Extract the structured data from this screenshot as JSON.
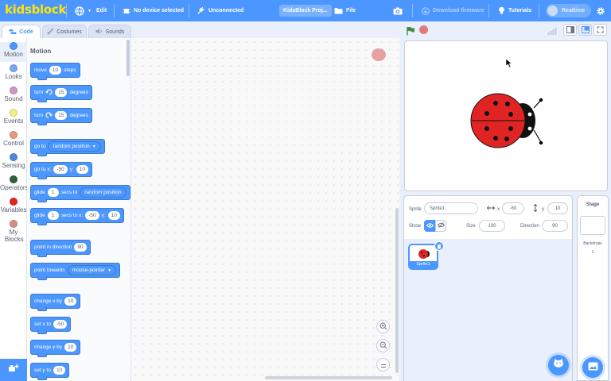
{
  "menubar": {
    "logo": "kidsblock",
    "edit": "Edit",
    "device": "No device selected",
    "connection": "Unconnected",
    "project_title": "KidsBlock Proj...",
    "file": "File",
    "download_firmware": "Download firmware",
    "tutorials": "Tutorials",
    "realtime": "Realtime"
  },
  "tabs": [
    {
      "label": "Code",
      "icon": "code-icon"
    },
    {
      "label": "Costumes",
      "icon": "brush-icon"
    },
    {
      "label": "Sounds",
      "icon": "speaker-icon"
    }
  ],
  "categories": [
    {
      "label": "Motion",
      "color": "#4c97ff"
    },
    {
      "label": "Looks",
      "color": "#9966ff"
    },
    {
      "label": "Sound",
      "color": "#cf63cf"
    },
    {
      "label": "Events",
      "color": "#ffd500"
    },
    {
      "label": "Control",
      "color": "#ffab19"
    },
    {
      "label": "Sensing",
      "color": "#5cb1d6"
    },
    {
      "label": "Operators",
      "color": "#2e5e3a"
    },
    {
      "label": "Variables",
      "color": "#e52222"
    },
    {
      "label": "My Blocks",
      "color": "#ff6680"
    }
  ],
  "palette": {
    "title": "Motion",
    "blocks": {
      "move": {
        "t1": "move",
        "v1": "10",
        "t2": "steps"
      },
      "turn_right": {
        "t1": "turn",
        "v1": "15",
        "t2": "degrees"
      },
      "turn_left": {
        "t1": "turn",
        "v1": "15",
        "t2": "degrees"
      },
      "goto": {
        "t1": "go to",
        "d1": "random position"
      },
      "goto_xy": {
        "t1": "go to x:",
        "v1": "-50",
        "t2": "y:",
        "v2": "10"
      },
      "glide_to": {
        "t1": "glide",
        "v1": "1",
        "t2": "secs to",
        "d1": "random position"
      },
      "glide_xy": {
        "t1": "glide",
        "v1": "1",
        "t2": "secs to x:",
        "v2": "-50",
        "t3": "y:",
        "v3": "10"
      },
      "point_dir": {
        "t1": "point in direction",
        "v1": "90"
      },
      "point_towards": {
        "t1": "point towards",
        "d1": "mouse-pointer"
      },
      "change_x": {
        "t1": "change x by",
        "v1": "10"
      },
      "set_x": {
        "t1": "set x to",
        "v1": "-50"
      },
      "change_y": {
        "t1": "change y by",
        "v1": "10"
      },
      "set_y": {
        "t1": "set y to",
        "v1": "10"
      }
    }
  },
  "sprite_info": {
    "sprite_label": "Sprite",
    "sprite_name": "Sprite1",
    "x_label": "x",
    "x_value": "-50",
    "y_label": "y",
    "y_value": "10",
    "show_label": "Show",
    "size_label": "Size",
    "size_value": "100",
    "direction_label": "Direction",
    "direction_value": "90"
  },
  "sprites": [
    {
      "name": "Sprite1"
    }
  ],
  "stage_panel": {
    "title": "Stage",
    "backdrops_label": "Backdrops",
    "backdrops_count": "1"
  },
  "colors": {
    "accent": "#4c97ff",
    "ladybug_red": "#e02424",
    "logo_yellow": "#ffe500"
  }
}
